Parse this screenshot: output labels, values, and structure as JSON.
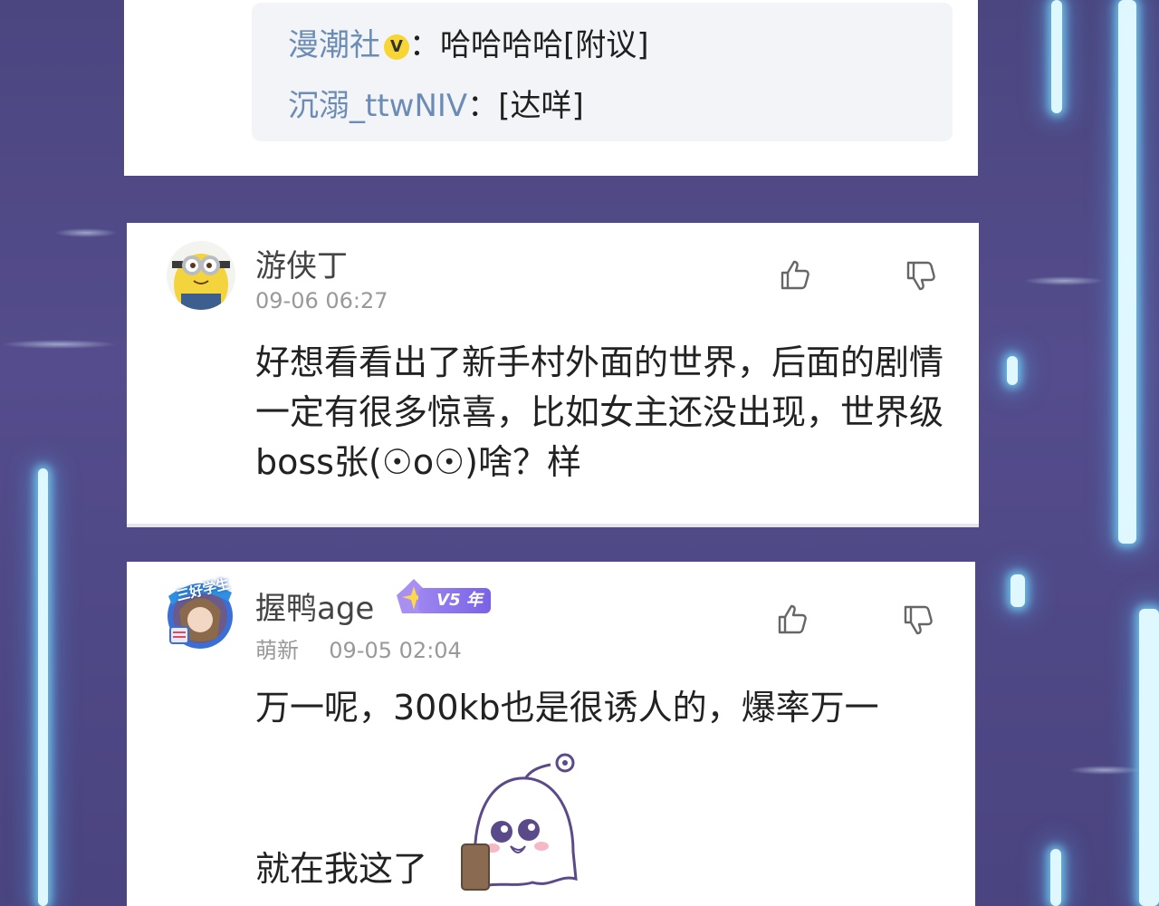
{
  "reply_thread": {
    "replies": [
      {
        "name": "漫潮社",
        "separator": "：",
        "text": "哈哈哈哈[附议]",
        "verified_badge": "V"
      },
      {
        "name": "沉溺_ttwNIV",
        "separator": "：",
        "text": "[达咩]"
      }
    ]
  },
  "comments": [
    {
      "username": "游侠丁",
      "time": "09-06 06:27",
      "text": "好想看看出了新手村外面的世界，后面的剧情一定有很多惊喜，比如女主还没出现，世界级boss张(☉o☉)啥？样",
      "avatar_icon": "minion-avatar-icon",
      "like_icon": "thumbs-up-icon",
      "dislike_icon": "thumbs-down-icon"
    },
    {
      "username": "握鸭age",
      "vip_label": "V5 年",
      "level_tag": "萌新",
      "time": "09-05 02:04",
      "text_line1": "万一呢，300kb也是很诱人的，爆率万一",
      "text_line2": "就在我这了",
      "avatar_frame_text": "三好学生",
      "avatar_icon": "anime-character-avatar-icon",
      "sticker_icon": "ghost-sticker-icon",
      "like_icon": "thumbs-up-icon",
      "dislike_icon": "thumbs-down-icon"
    }
  ]
}
